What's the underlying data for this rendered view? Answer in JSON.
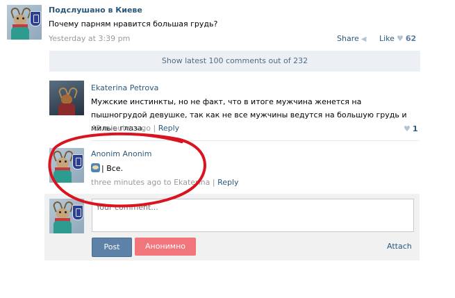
{
  "post": {
    "author": "Подслушано в Киеве",
    "text": "Почему парням нравится большая грудь?",
    "time": "Yesterday at 3:39 pm",
    "share_label": "Share",
    "like_label": "Like",
    "like_count": "62"
  },
  "show_comments": "Show latest 100 comments out of 232",
  "comments": [
    {
      "author": "Ekaterina Petrova",
      "text": "Мужские инстинкты, но не факт, что в итоге мужчина женется на пышногрудой девушке, так как не все мужчины ведутся на большую грудь и милые глаза.",
      "time": "42 minutes ago",
      "separator": "|",
      "reply": "Reply",
      "likes": "1"
    },
    {
      "author": "Anonim Anonim",
      "text": "| Все.",
      "time": "three minutes ago to Ekaterina",
      "separator": "|",
      "reply": "Reply"
    }
  ],
  "compose": {
    "placeholder": "Your comment...",
    "post_button": "Post",
    "anon_button": "Анонимно",
    "attach": "Attach"
  },
  "colors": {
    "link": "#2b587a",
    "annotation": "#d9141f",
    "post_button": "#5e81a8",
    "anon_button": "#f0767b"
  },
  "icons": [
    "avatar-deer-shield",
    "megaphone-icon",
    "heart-icon",
    "emoji-icon"
  ]
}
